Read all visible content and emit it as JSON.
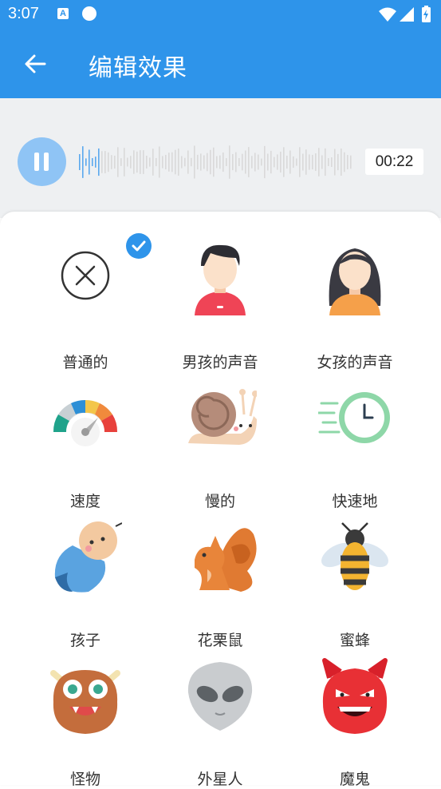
{
  "status_bar": {
    "time": "3:07",
    "notif_a": "A"
  },
  "app_bar": {
    "title": "编辑效果"
  },
  "player": {
    "time": "00:22",
    "state": "playing"
  },
  "effects": [
    {
      "label": "普通的",
      "icon": "none-icon",
      "selected": true
    },
    {
      "label": "男孩的声音",
      "icon": "boy-icon",
      "selected": false
    },
    {
      "label": "女孩的声音",
      "icon": "girl-icon",
      "selected": false
    },
    {
      "label": "速度",
      "icon": "speedometer-icon",
      "selected": false
    },
    {
      "label": "慢的",
      "icon": "snail-icon",
      "selected": false
    },
    {
      "label": "快速地",
      "icon": "fast-clock-icon",
      "selected": false
    },
    {
      "label": "孩子",
      "icon": "baby-icon",
      "selected": false
    },
    {
      "label": "花栗鼠",
      "icon": "squirrel-icon",
      "selected": false
    },
    {
      "label": "蜜蜂",
      "icon": "bee-icon",
      "selected": false
    },
    {
      "label": "怪物",
      "icon": "monster-icon",
      "selected": false
    },
    {
      "label": "外星人",
      "icon": "alien-icon",
      "selected": false
    },
    {
      "label": "魔鬼",
      "icon": "devil-icon",
      "selected": false
    }
  ],
  "colors": {
    "primary": "#2e94ea",
    "player_bg": "#eef0f2",
    "play_button": "#8fc4f5"
  }
}
